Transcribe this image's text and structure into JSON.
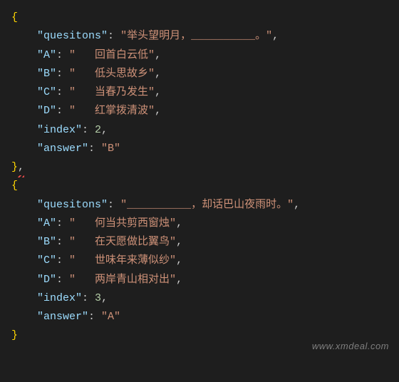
{
  "code": {
    "obj1": {
      "open": "{",
      "k_questions": "\"quesitons\"",
      "v_questions": "\"举头望明月，__________。\"",
      "k_a": "\"A\"",
      "v_a": "\"   回首白云低\"",
      "k_b": "\"B\"",
      "v_b": "\"   低头思故乡\"",
      "k_c": "\"C\"",
      "v_c": "\"   当春乃发生\"",
      "k_d": "\"D\"",
      "v_d": "\"   红掌拨清波\"",
      "k_index": "\"index\"",
      "v_index": "2",
      "k_answer": "\"answer\"",
      "v_answer": "\"B\"",
      "close": "}",
      "close_comma": ","
    },
    "obj2": {
      "open": "{",
      "k_questions": "\"quesitons\"",
      "v_questions": "\"__________，却话巴山夜雨时。\"",
      "k_a": "\"A\"",
      "v_a": "\"   何当共剪西窗烛\"",
      "k_b": "\"B\"",
      "v_b": "\"   在天愿做比翼鸟\"",
      "k_c": "\"C\"",
      "v_c": "\"   世味年来薄似纱\"",
      "k_d": "\"D\"",
      "v_d": "\"   两岸青山相对出\"",
      "k_index": "\"index\"",
      "v_index": "3",
      "k_answer": "\"answer\"",
      "v_answer": "\"A\"",
      "close": "}"
    },
    "colon_sep": ": ",
    "comma": ",",
    "indent1": "    "
  },
  "watermark": "www.xmdeal.com"
}
